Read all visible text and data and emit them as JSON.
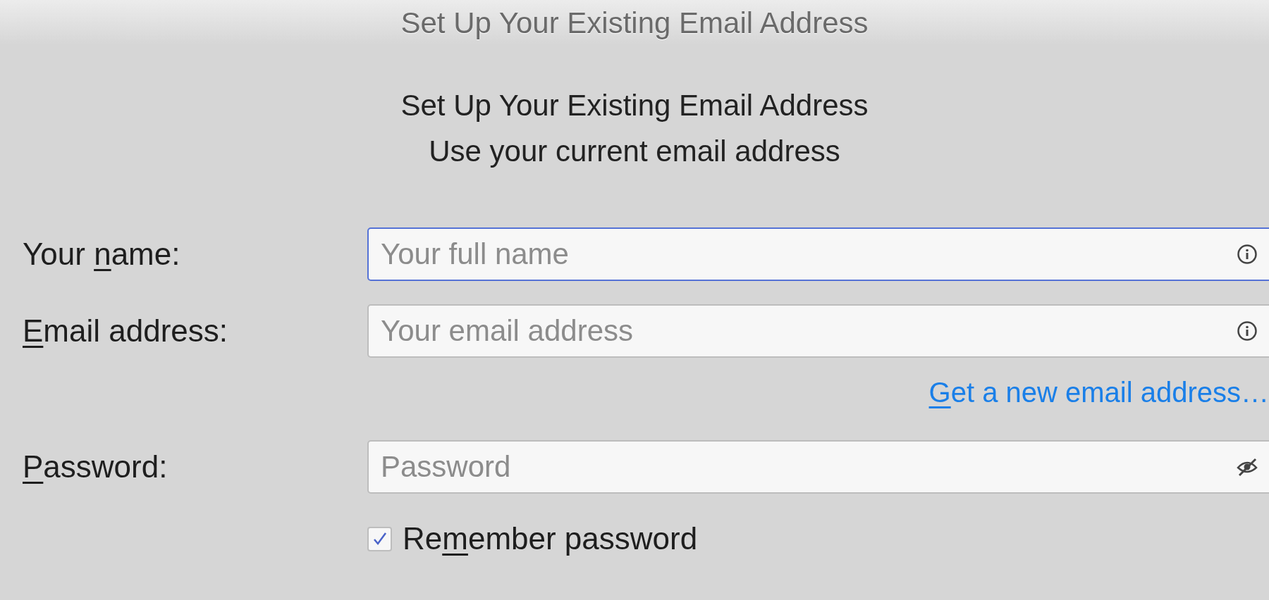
{
  "window": {
    "title": "Set Up Your Existing Email Address"
  },
  "heading": {
    "title": "Set Up Your Existing Email Address",
    "subtitle": "Use your current email address"
  },
  "fields": [
    {
      "kind": "info",
      "label": {
        "before": "Your ",
        "access_key": "n",
        "after": "ame:"
      },
      "placeholder": "Your full name",
      "focused": true
    },
    {
      "kind": "info",
      "label": {
        "access_key": "E",
        "after": "mail address:"
      },
      "placeholder": "Your email address",
      "focused": false
    },
    {
      "kind": "password",
      "label": {
        "access_key": "P",
        "after": "assword:"
      },
      "placeholder": "Password",
      "focused": false
    }
  ],
  "new_address_link": {
    "text": {
      "access_key": "G",
      "after": "et a new email address…"
    }
  },
  "remember_password": {
    "label": {
      "before": "Re",
      "access_key": "m",
      "after": "ember password"
    },
    "checked": true
  }
}
